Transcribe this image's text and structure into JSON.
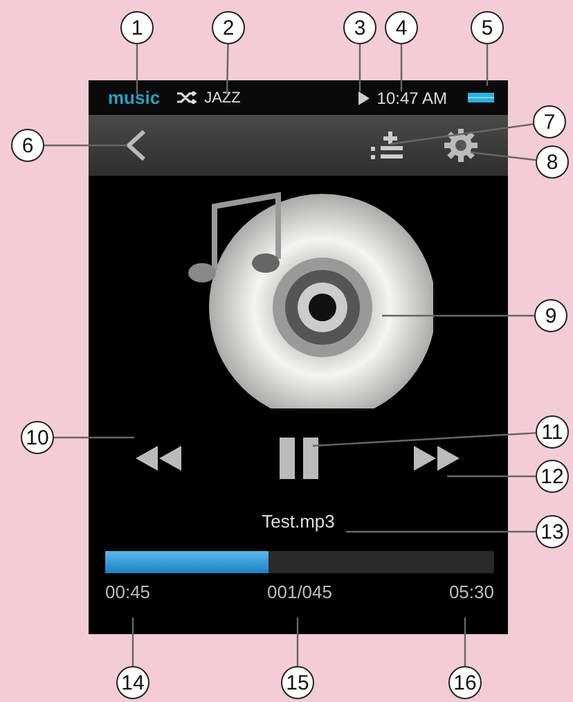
{
  "status_bar": {
    "app_label": "music",
    "genre": "JAZZ",
    "time": "10:47 AM"
  },
  "now_playing": {
    "track_name": "Test.mp3",
    "progress": {
      "level": 0.42
    },
    "elapsed": "00:45",
    "track_index": "001/045",
    "total": "05:30"
  },
  "callouts": [
    "1",
    "2",
    "3",
    "4",
    "5",
    "6",
    "7",
    "8",
    "9",
    "10",
    "11",
    "12",
    "13",
    "14",
    "15",
    "16"
  ]
}
